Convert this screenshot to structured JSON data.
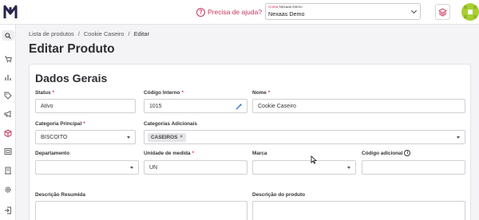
{
  "header": {
    "help_label": "Precisa de ajuda?",
    "account_label_prefix": "Conta",
    "account_label_name": "Nexaas Demo",
    "account_value": "Nexaas Demo"
  },
  "breadcrumb": {
    "items": [
      "Lista de produtos",
      "/",
      "Cookie Caseiro",
      "/",
      "Editar"
    ]
  },
  "page": {
    "title": "Editar Produto"
  },
  "section": {
    "title": "Dados Gerais"
  },
  "fields": {
    "status": {
      "label": "Status",
      "required": "*",
      "value": "Ativo"
    },
    "codigo_interno": {
      "label": "Código Interno",
      "required": "*",
      "value": "1015"
    },
    "nome": {
      "label": "Nome",
      "required": "*",
      "value": "Cookie Caseiro"
    },
    "categoria_principal": {
      "label": "Categoria Principal",
      "required": "*",
      "value": "BISCOITO"
    },
    "categorias_adicionais": {
      "label": "Categorias Adicionais",
      "tag": "CASEIROS",
      "tag_remove": "×"
    },
    "departamento": {
      "label": "Departamento",
      "value": ""
    },
    "unidade_medida": {
      "label": "Unidade de medida",
      "required": "*",
      "value": "UN"
    },
    "marca": {
      "label": "Marca",
      "value": ""
    },
    "codigo_adicional": {
      "label": "Código adicional",
      "info": "i",
      "value": ""
    },
    "descricao_resumida": {
      "label": "Descrição Resumida",
      "value": ""
    },
    "descricao_produto": {
      "label": "Descrição do produto",
      "value": ""
    }
  },
  "icons": {
    "logo": "nexaas-logo",
    "help": "question-circle-icon",
    "layers": "layers-icon",
    "sidebar": [
      "search-icon",
      "cart-icon",
      "bar-chart-icon",
      "tag-icon",
      "megaphone-icon",
      "box-icon",
      "image-icon",
      "building-icon",
      "gear-icon",
      "logout-icon"
    ]
  },
  "colors": {
    "accent": "#c8345e",
    "avatar": "#a9cf33",
    "logo": "#26244a"
  }
}
